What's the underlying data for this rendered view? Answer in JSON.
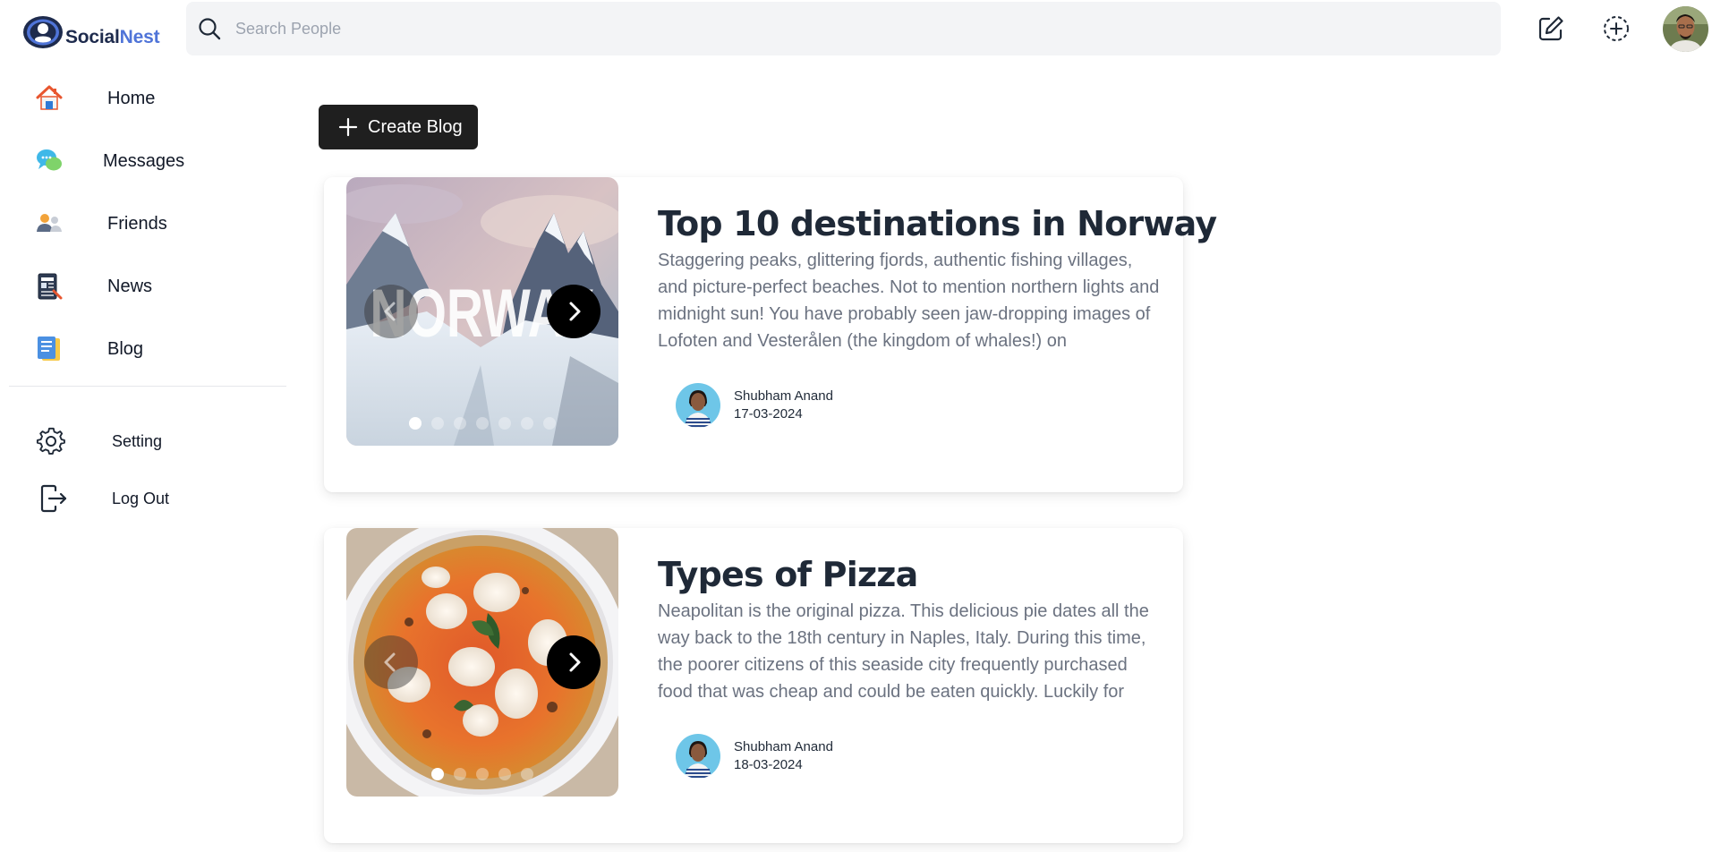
{
  "app": {
    "brand_part1": "Social",
    "brand_part2": "Nest"
  },
  "search": {
    "placeholder": "Search People",
    "value": ""
  },
  "header_actions": [
    {
      "name": "edit-icon"
    },
    {
      "name": "add-circle-icon"
    },
    {
      "name": "profile-avatar"
    }
  ],
  "sidebar": {
    "items": [
      {
        "label": "Home",
        "icon": "home-icon"
      },
      {
        "label": "Messages",
        "icon": "messages-icon"
      },
      {
        "label": "Friends",
        "icon": "friends-icon"
      },
      {
        "label": "News",
        "icon": "news-icon"
      },
      {
        "label": "Blog",
        "icon": "blog-icon"
      }
    ],
    "bottom_items": [
      {
        "label": "Setting",
        "icon": "gear-icon"
      },
      {
        "label": "Log Out",
        "icon": "logout-icon"
      }
    ]
  },
  "main": {
    "create_label": "Create Blog",
    "posts": [
      {
        "title": "Top 10 destinations in Norway",
        "excerpt": "Staggering peaks, glittering fjords, authentic fishing villages, and picture-perfect beaches. Not to mention northern lights and midnight sun! You have probably seen jaw-dropping images of Lofoten and Vesterålen (the kingdom of whales!) on",
        "image_text": "NORWAY",
        "author": "Shubham Anand",
        "date": "17-03-2024",
        "slide_count": 7,
        "active_slide": 1
      },
      {
        "title": "Types of Pizza",
        "excerpt": "Neapolitan is the original pizza. This delicious pie dates all the way back to the 18th century in Naples, Italy. During this time, the poorer citizens of this seaside city frequently purchased food that was cheap and could be eaten quickly. Luckily for",
        "author": "Shubham Anand",
        "date": "18-03-2024",
        "slide_count": 5,
        "active_slide": 1
      }
    ]
  },
  "colors": {
    "brand_dark": "#1e2b4d",
    "brand_blue": "#4f74d8",
    "button_dark": "#1f1f1f"
  }
}
